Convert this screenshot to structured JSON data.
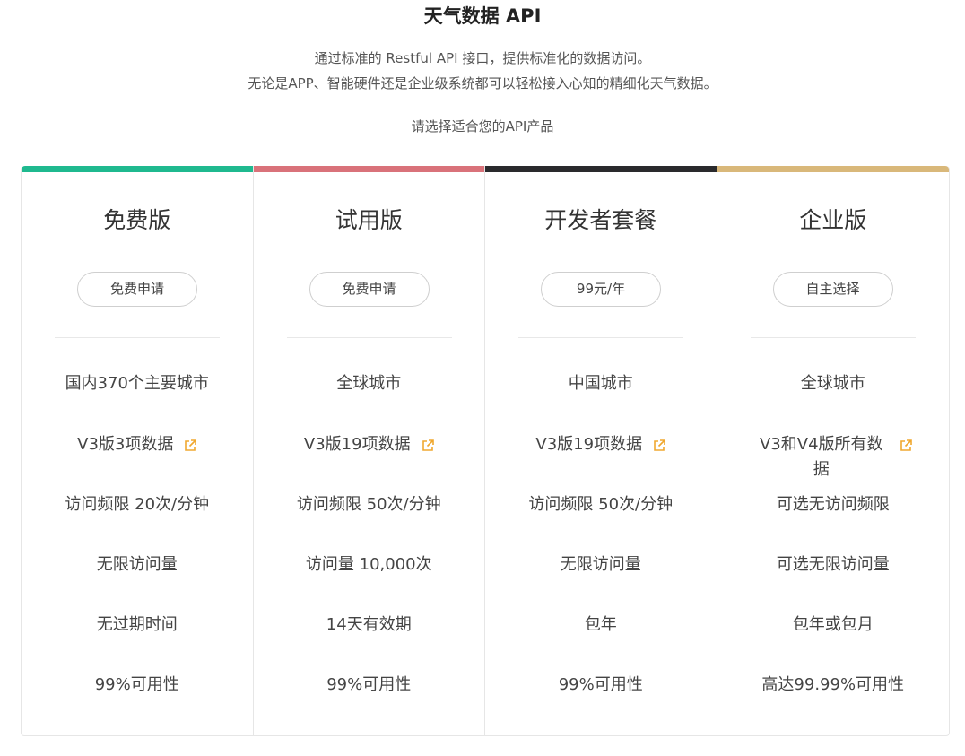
{
  "header": {
    "title": "天气数据 API",
    "desc_line1": "通过标准的 Restful API 接口，提供标准化的数据访问。",
    "desc_line2": "无论是APP、智能硬件还是企业级系统都可以轻松接入心知的精细化天气数据。",
    "select_prompt": "请选择适合您的API产品"
  },
  "plans": [
    {
      "name": "免费版",
      "button": "免费申请",
      "accent_color": "#1fb98f",
      "features": [
        "国内370个主要城市",
        "V3版3项数据",
        "访问频限 20次/分钟",
        "无限访问量",
        "无过期时间",
        "99%可用性"
      ]
    },
    {
      "name": "试用版",
      "button": "免费申请",
      "accent_color": "#d9727a",
      "features": [
        "全球城市",
        "V3版19项数据",
        "访问频限 50次/分钟",
        "访问量 10,000次",
        "14天有效期",
        "99%可用性"
      ]
    },
    {
      "name": "开发者套餐",
      "button": "99元/年",
      "accent_color": "#2a2a2d",
      "features": [
        "中国城市",
        "V3版19项数据",
        "访问频限 50次/分钟",
        "无限访问量",
        "包年",
        "99%可用性"
      ]
    },
    {
      "name": "企业版",
      "button": "自主选择",
      "accent_color": "#d9b87a",
      "features": [
        "全球城市",
        "V3和V4版所有数据",
        "可选无访问频限",
        "可选无限访问量",
        "包年或包月",
        "高达99.99%可用性"
      ]
    }
  ],
  "colors": {
    "link_icon": "#f0a830",
    "border": "#e6e6e6"
  },
  "icons": {
    "data_link": "external-link-icon"
  }
}
